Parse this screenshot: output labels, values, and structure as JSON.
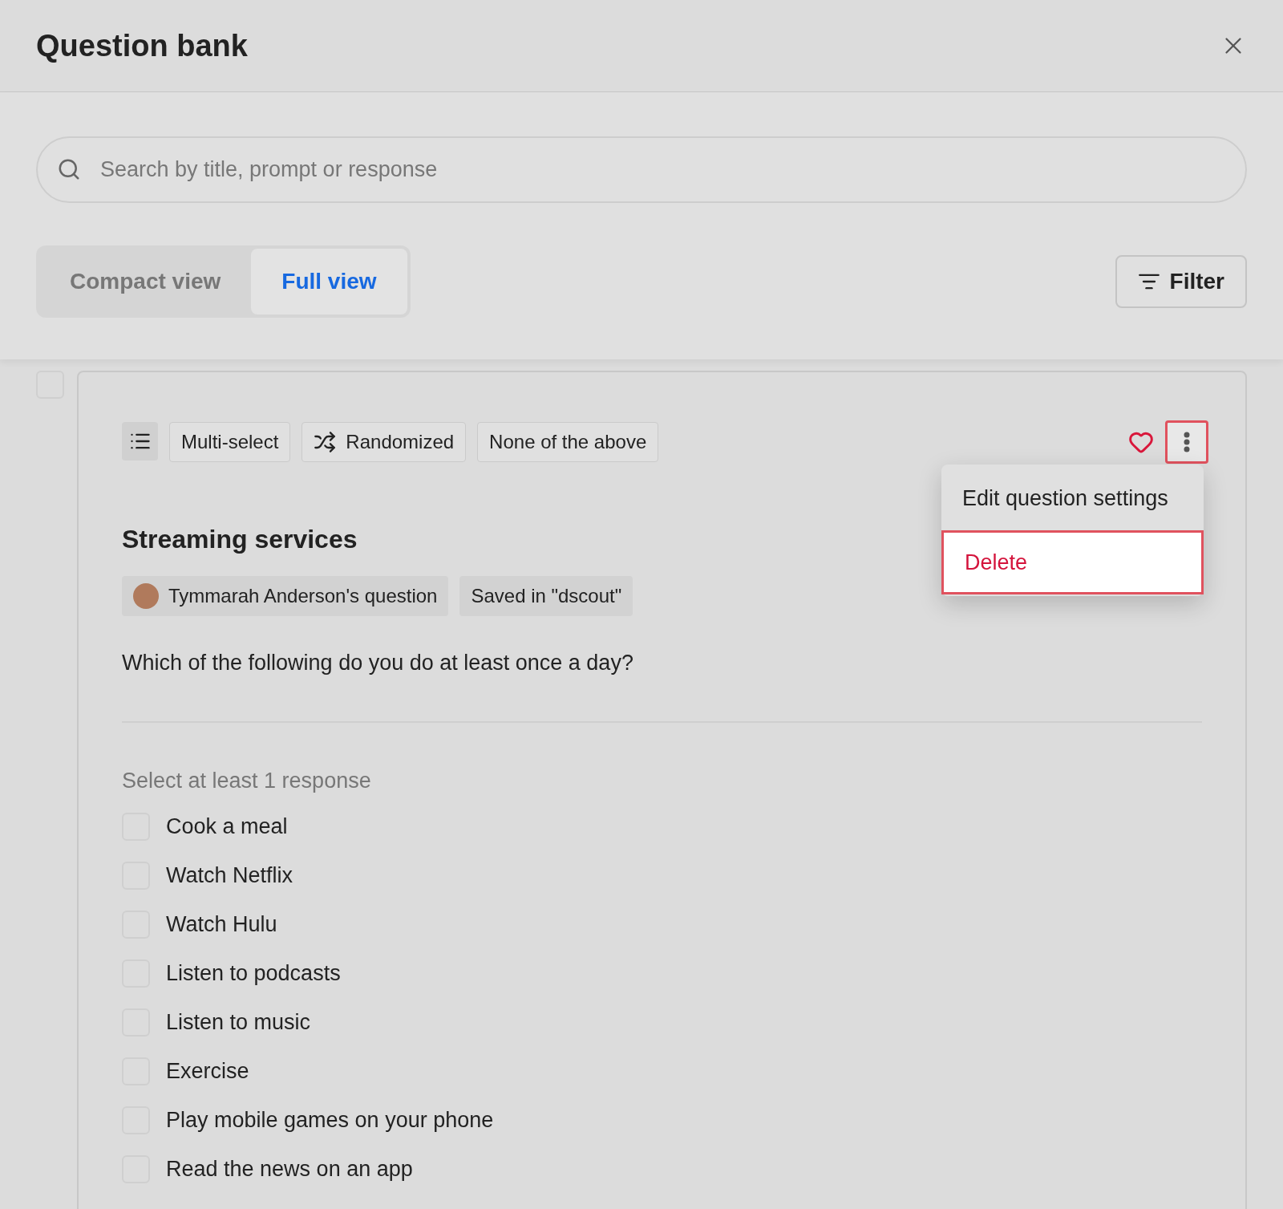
{
  "dialog": {
    "title": "Question bank"
  },
  "search": {
    "placeholder": "Search by title, prompt or response"
  },
  "view_tabs": [
    {
      "label": "Compact view",
      "selected": false
    },
    {
      "label": "Full view",
      "selected": true
    }
  ],
  "filter_button": {
    "label": "Filter"
  },
  "question": {
    "checked": false,
    "tags": [
      {
        "kind": "icon"
      },
      {
        "kind": "text",
        "label": "Multi-select"
      },
      {
        "kind": "shuffle",
        "label": "Randomized"
      },
      {
        "kind": "text",
        "label": "None of the above"
      }
    ],
    "favorite": true,
    "more_button": {
      "highlighted": true
    },
    "menu": [
      {
        "label": "Edit question settings",
        "kind": "normal",
        "highlighted": false
      },
      {
        "label": "Delete",
        "kind": "danger",
        "highlighted": true
      }
    ],
    "title": "Streaming services",
    "chips": [
      {
        "kind": "author",
        "label": "Tymmarah Anderson's question"
      },
      {
        "kind": "text",
        "label": "Saved in \"dscout\""
      }
    ],
    "prompt": "Which of the following do you do at least once a day?",
    "instruction": "Select at least 1 response",
    "options": [
      {
        "label": "Cook a meal",
        "checked": false
      },
      {
        "label": "Watch Netflix",
        "checked": false
      },
      {
        "label": "Watch Hulu",
        "checked": false
      },
      {
        "label": "Listen to podcasts",
        "checked": false
      },
      {
        "label": "Listen to music",
        "checked": false
      },
      {
        "label": "Exercise",
        "checked": false
      },
      {
        "label": "Play mobile games on your phone",
        "checked": false
      },
      {
        "label": "Read the news on an app",
        "checked": false
      }
    ]
  }
}
